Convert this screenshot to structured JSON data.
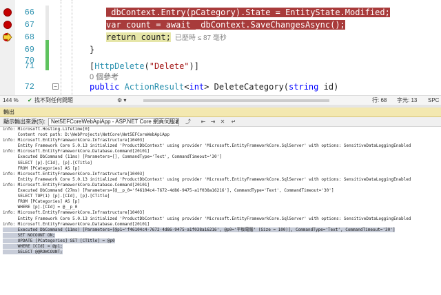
{
  "editor": {
    "lines": [
      {
        "num": "66",
        "bp": "dot",
        "parts": [
          {
            "t": "_dbContext.Entry(pCategory).State = EntityState.Modified;",
            "c": "hl"
          }
        ]
      },
      {
        "num": "67",
        "bp": "dot",
        "parts": [
          {
            "t": "var count = await _dbContext.SaveChangesAsync();",
            "c": "hl"
          }
        ]
      },
      {
        "num": "68",
        "bp": "arrow",
        "parts": [
          {
            "t": "return count;",
            "c": "hl2"
          }
        ],
        "perf": "已歷時 ≤ 87 毫秒"
      },
      {
        "num": "69",
        "bp": "",
        "parts": [
          {
            "t": "}",
            "c": ""
          }
        ]
      },
      {
        "num": "70",
        "bp": "",
        "parts": [
          {
            "t": "",
            "c": ""
          }
        ]
      },
      {
        "num": "71",
        "bp": "",
        "parts": [
          {
            "t": "[",
            "c": ""
          },
          {
            "t": "HttpDelete",
            "c": "ty"
          },
          {
            "t": "(",
            "c": ""
          },
          {
            "t": "\"Delete\"",
            "c": "str"
          },
          {
            "t": ")]",
            "c": ""
          }
        ]
      },
      {
        "num": "",
        "bp": "",
        "ref": "0 個參考"
      },
      {
        "num": "72",
        "bp": "",
        "parts": [
          {
            "t": "public ",
            "c": "kw"
          },
          {
            "t": "ActionResult",
            "c": "ty"
          },
          {
            "t": "<",
            "c": ""
          },
          {
            "t": "int",
            "c": "kw"
          },
          {
            "t": "> DeleteCategory(",
            "c": ""
          },
          {
            "t": "string",
            "c": "kw"
          },
          {
            "t": " id)",
            "c": ""
          }
        ]
      }
    ]
  },
  "statusbar": {
    "zoom": "144 %",
    "issues": "找不到任何問題",
    "line": "行: 68",
    "char": "字元: 13",
    "mode": "SPC"
  },
  "output": {
    "title": "輸出",
    "show_label": "顯示輸出來源(S):",
    "source": "Net5EFCoreWebApiApp - ASP.NET Core 網頁伺服器",
    "lines": [
      "info: Microsoft.Hosting.Lifetime[0]",
      "      Content root path: D:\\WebProjects\\NetCore\\Net5EFCoreWebApiApp",
      "info: Microsoft.EntityFrameworkCore.Infrastructure[10403]",
      "      Entity Framework Core 5.0.13 initialized 'ProductDbContext' using provider 'Microsoft.EntityFrameworkCore.SqlServer' with options: SensitiveDataLoggingEnabled",
      "info: Microsoft.EntityFrameworkCore.Database.Command[20101]",
      "      Executed DbCommand (11ms) [Parameters=[], CommandType='Text', CommandTimeout='30']",
      "      SELECT [p].[CId], [p].[CTitle]",
      "      FROM [PCategories] AS [p]",
      "info: Microsoft.EntityFrameworkCore.Infrastructure[10403]",
      "      Entity Framework Core 5.0.13 initialized 'ProductDbContext' using provider 'Microsoft.EntityFrameworkCore.SqlServer' with options: SensitiveDataLoggingEnabled",
      "info: Microsoft.EntityFrameworkCore.Database.Command[20101]",
      "      Executed DbCommand (27ms) [Parameters=[@__p_0='f46104c4-7672-4d86-9475-a1f038a16216'], CommandType='Text', CommandTimeout='30']",
      "      SELECT TOP(1) [p].[CId], [p].[CTitle]",
      "      FROM [PCategories] AS [p]",
      "      WHERE [p].[CId] = @__p_0",
      "info: Microsoft.EntityFrameworkCore.Infrastructure[10403]",
      "      Entity Framework Core 5.0.13 initialized 'ProductDbContext' using provider 'Microsoft.EntityFrameworkCore.SqlServer' with options: SensitiveDataLoggingEnabled",
      "info: Microsoft.EntityFrameworkCore.Database.Command[20101]",
      "      Executed DbCommand (11ms) [Parameters=[@p1='f46104c4-7672-4d86-9475-a1f038a16216', @p0='平板電腦' (Size = 100)], CommandType='Text', CommandTimeout='30']",
      "      SET NOCOUNT ON;",
      "      UPDATE [PCategories] SET [CTitle] = @p0",
      "      WHERE [CId] = @p1;",
      "      SELECT @@ROWCOUNT;"
    ],
    "selected_from": 18
  }
}
